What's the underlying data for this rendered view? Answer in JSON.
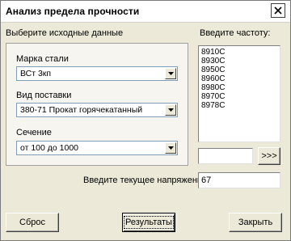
{
  "window": {
    "title": "Анализ предела прочности"
  },
  "icons": {
    "close": "close-icon",
    "dropdown": "chevron-down-icon"
  },
  "left_section": {
    "heading": "Выберите исходные данные"
  },
  "steel_grade": {
    "label": "Марка стали",
    "selected": "ВСт 3кп"
  },
  "delivery_type": {
    "label": "Вид поставки",
    "selected": "380-71 Прокат горячекатанный"
  },
  "section": {
    "label": "Сечение",
    "selected": "от 100 до 1000"
  },
  "frequency": {
    "label": "Введите частоту:",
    "items": [
      "8910С",
      "8930С",
      "8950С",
      "8960С",
      "8980С",
      "8970С",
      "8978С"
    ],
    "input_value": "",
    "add_button": ">>>"
  },
  "current_stress": {
    "label": "Введите текущее напряжение:",
    "value": "67"
  },
  "buttons": {
    "reset": "Сброс",
    "results": "Результаты",
    "close": "Закрыть"
  }
}
